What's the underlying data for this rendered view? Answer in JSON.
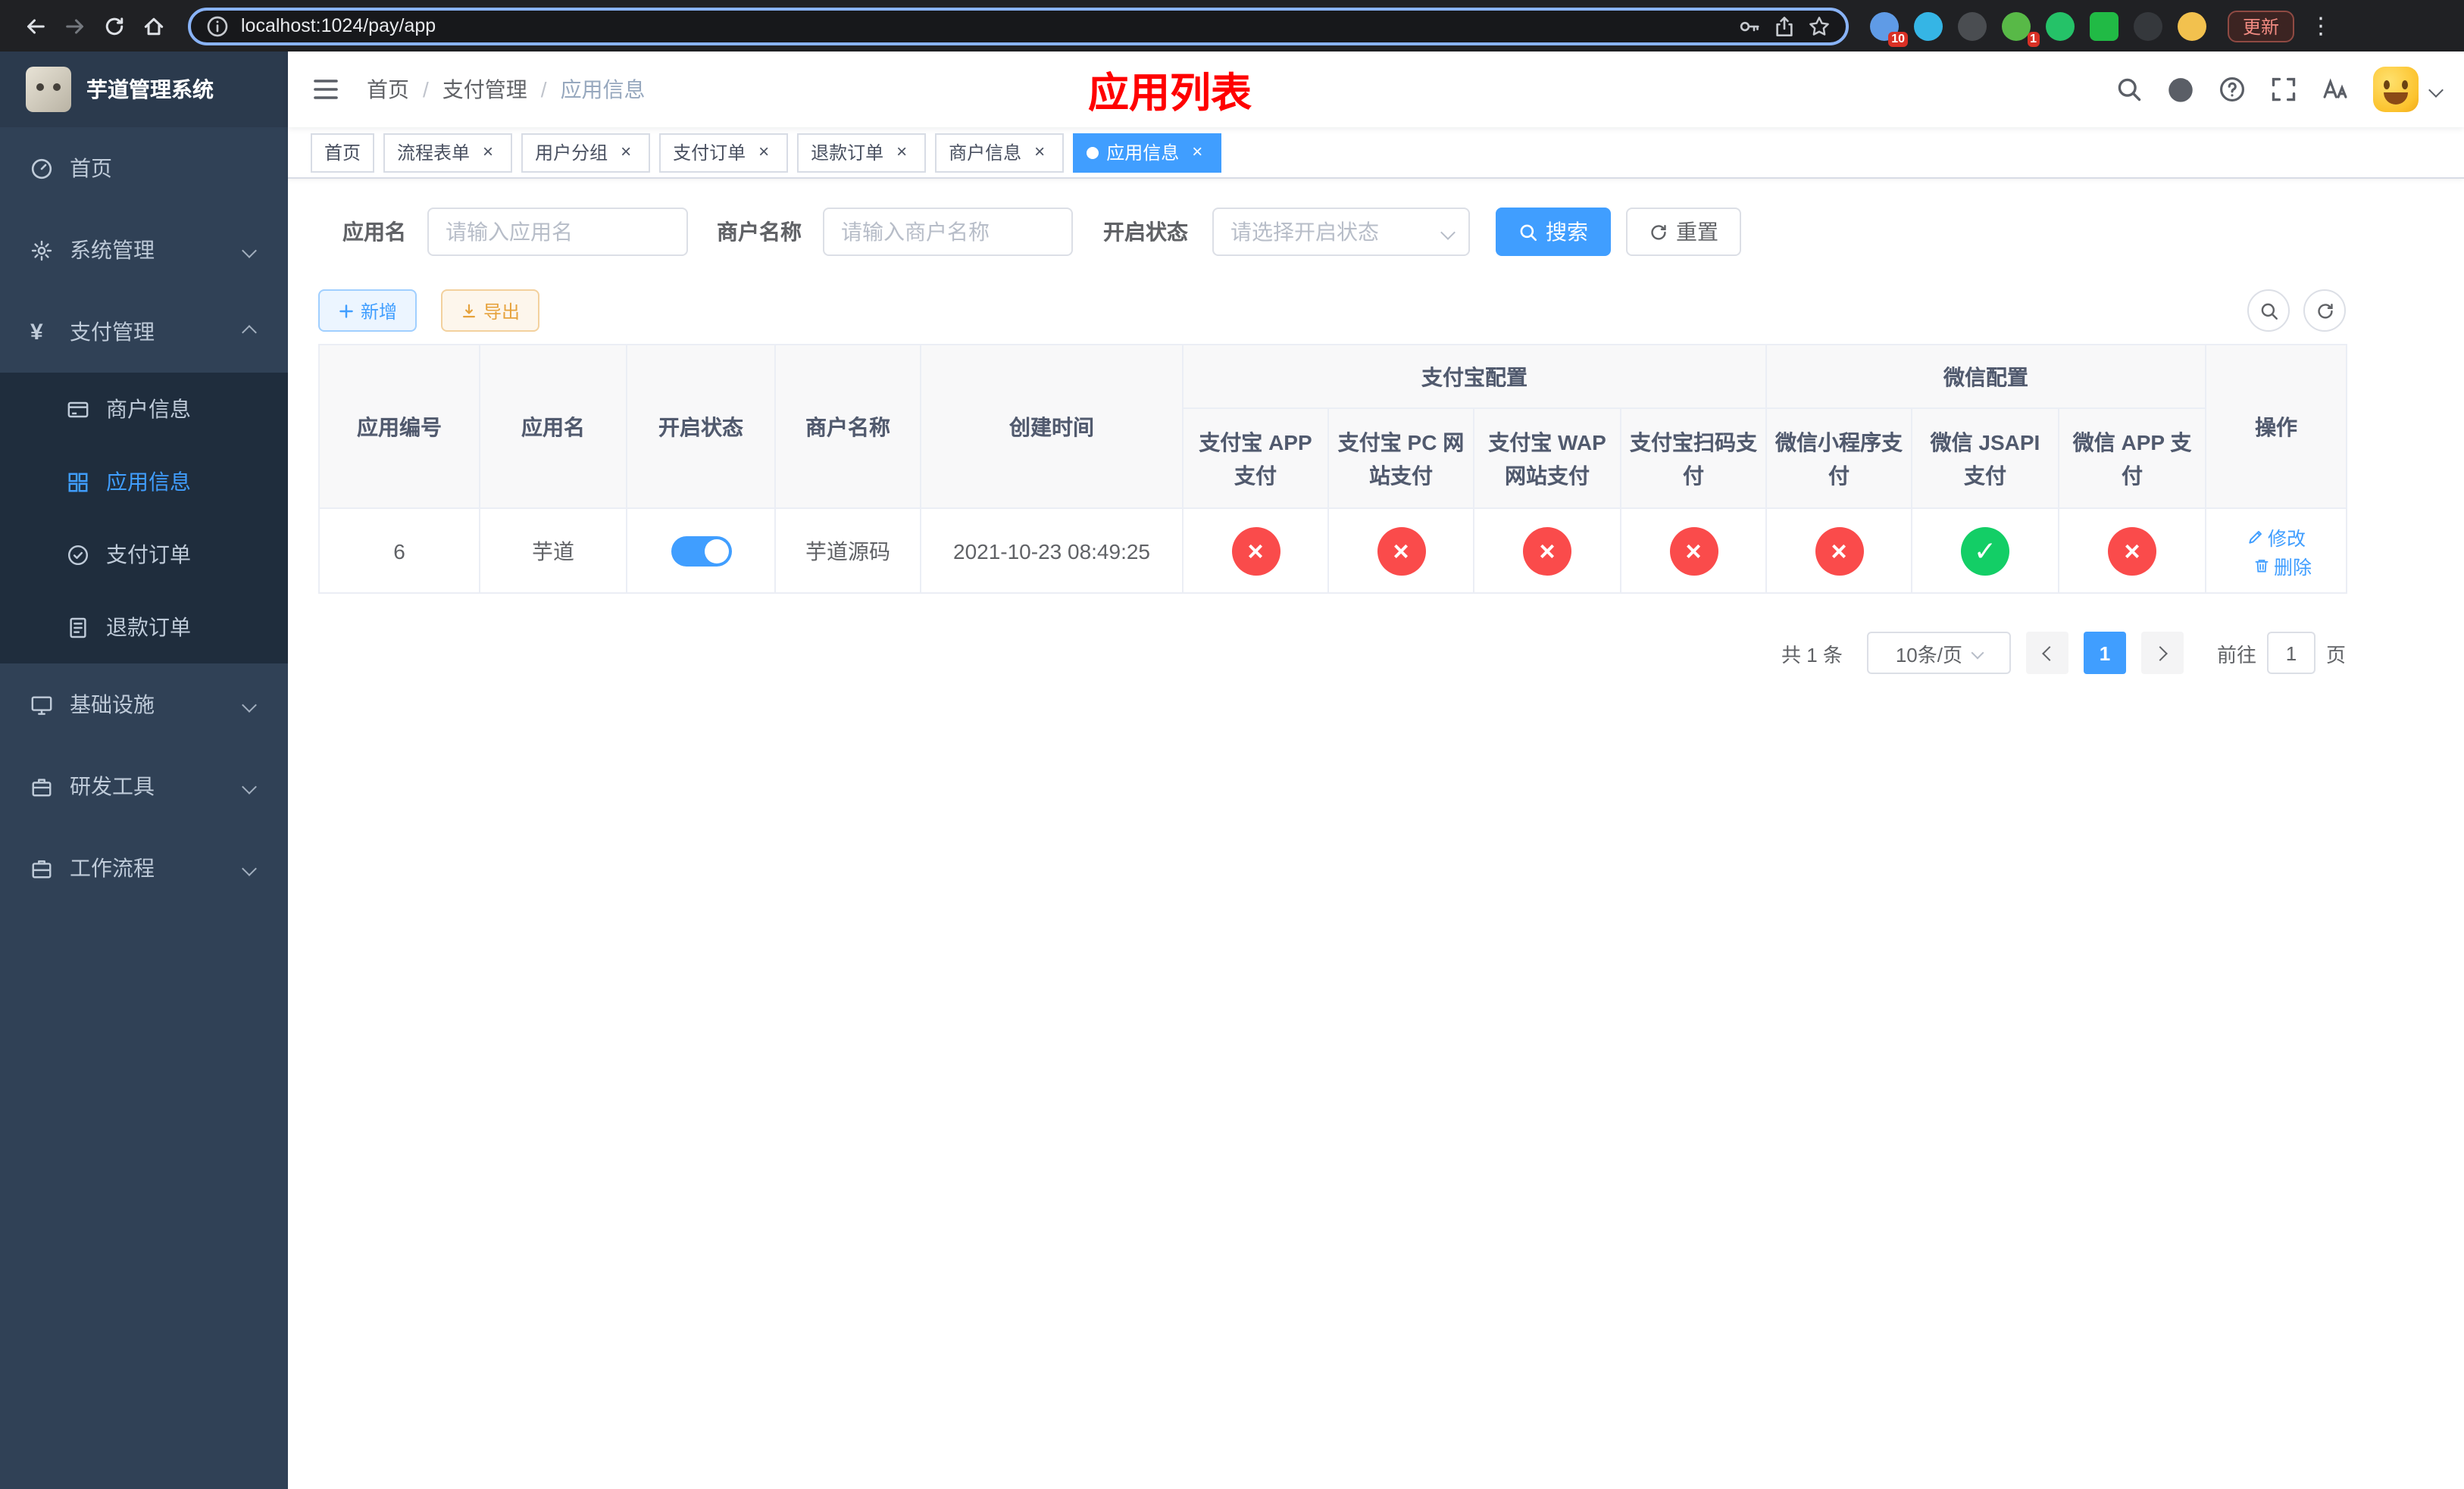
{
  "colors": {
    "accent": "#409eff",
    "danger": "#fa4b4b",
    "success": "#13ce66",
    "title_red": "#ff0000",
    "warning_text": "#e6a23c"
  },
  "browser": {
    "url": "localhost:1024/pay/app",
    "update_button": "更新",
    "ext_badge_1": "10",
    "ext_badge_2": "1"
  },
  "sidebar": {
    "title": "芋道管理系统",
    "menu": [
      {
        "label": "首页"
      },
      {
        "label": "系统管理"
      },
      {
        "label": "支付管理"
      },
      {
        "label": "基础设施"
      },
      {
        "label": "研发工具"
      },
      {
        "label": "工作流程"
      }
    ],
    "submenu": [
      {
        "label": "商户信息"
      },
      {
        "label": "应用信息"
      },
      {
        "label": "支付订单"
      },
      {
        "label": "退款订单"
      }
    ]
  },
  "breadcrumb": [
    "首页",
    "支付管理",
    "应用信息"
  ],
  "page_title": "应用列表",
  "tabs": [
    {
      "label": "首页"
    },
    {
      "label": "流程表单"
    },
    {
      "label": "用户分组"
    },
    {
      "label": "支付订单"
    },
    {
      "label": "退款订单"
    },
    {
      "label": "商户信息"
    },
    {
      "label": "应用信息"
    }
  ],
  "filters": {
    "app_name_label": "应用名",
    "app_name_placeholder": "请输入应用名",
    "merchant_label": "商户名称",
    "merchant_placeholder": "请输入商户名称",
    "status_label": "开启状态",
    "status_placeholder": "请选择开启状态",
    "search_button": "搜索",
    "reset_button": "重置"
  },
  "toolbar": {
    "add_button": "新增",
    "export_button": "导出"
  },
  "table": {
    "headers": {
      "app_id": "应用编号",
      "app_name": "应用名",
      "status": "开启状态",
      "merchant": "商户名称",
      "created": "创建时间",
      "alipay_group": "支付宝配置",
      "wechat_group": "微信配置",
      "alipay_app": "支付宝 APP 支付",
      "alipay_pc": "支付宝 PC 网站支付",
      "alipay_wap": "支付宝 WAP 网站支付",
      "alipay_qr": "支付宝扫码支付",
      "wechat_mini": "微信小程序支付",
      "wechat_jsapi": "微信 JSAPI 支付",
      "wechat_app": "微信 APP 支付",
      "actions": "操作"
    },
    "rows": [
      {
        "app_id": "6",
        "app_name": "芋道",
        "enabled": true,
        "merchant": "芋道源码",
        "created": "2021-10-23 08:49:25",
        "configs": {
          "alipay_app": "no",
          "alipay_pc": "no",
          "alipay_wap": "no",
          "alipay_qr": "no",
          "wechat_mini": "no",
          "wechat_jsapi": "yes",
          "wechat_app": "no"
        },
        "edit_label": "修改",
        "delete_label": "删除"
      }
    ]
  },
  "pagination": {
    "total": "共 1 条",
    "page_size": "10条/页",
    "current_page": "1",
    "goto_label": "前往",
    "goto_value": "1",
    "goto_unit": "页"
  }
}
